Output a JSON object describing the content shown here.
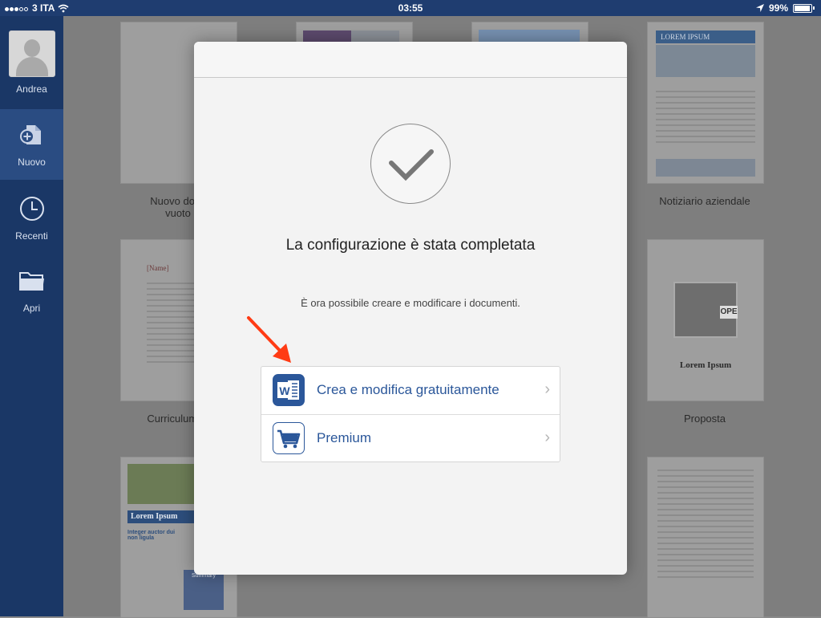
{
  "status_bar": {
    "carrier": "3 ITA",
    "time": "03:55",
    "battery": "99%"
  },
  "sidebar": {
    "user": {
      "label": "Andrea"
    },
    "items": [
      {
        "label": "Nuovo",
        "icon": "new-document-icon",
        "active": true
      },
      {
        "label": "Recenti",
        "icon": "clock-icon",
        "active": false
      },
      {
        "label": "Apri",
        "icon": "folder-icon",
        "active": false
      }
    ]
  },
  "templates": [
    {
      "caption": "Nuovo docu\nvuoto"
    },
    {
      "caption": "Notiziario aziendale"
    },
    {
      "caption": "Curriculum m"
    },
    {
      "caption": "Proposta"
    }
  ],
  "template_previews": {
    "newsletter_title": "LOREM IPSUM",
    "resume_name": "[Name]",
    "proposal_title": "Lorem Ipsum",
    "proposal_sign": "OPE",
    "flyer_title": "Lorem Ipsum",
    "flyer_heading": "Integer auctor dui non ligula",
    "flyer_summary": "Summary"
  },
  "modal": {
    "title": "La configurazione è stata completata",
    "subtitle": "È ora possibile creare e modificare i documenti.",
    "options": [
      {
        "label": "Crea e modifica gratuitamente",
        "icon": "word-icon",
        "icon_text": "W"
      },
      {
        "label": "Premium",
        "icon": "cart-icon"
      }
    ]
  },
  "colors": {
    "brand_blue": "#2b579a",
    "sidebar_bg": "#1a3766",
    "arrow_red": "#ff3b14"
  }
}
